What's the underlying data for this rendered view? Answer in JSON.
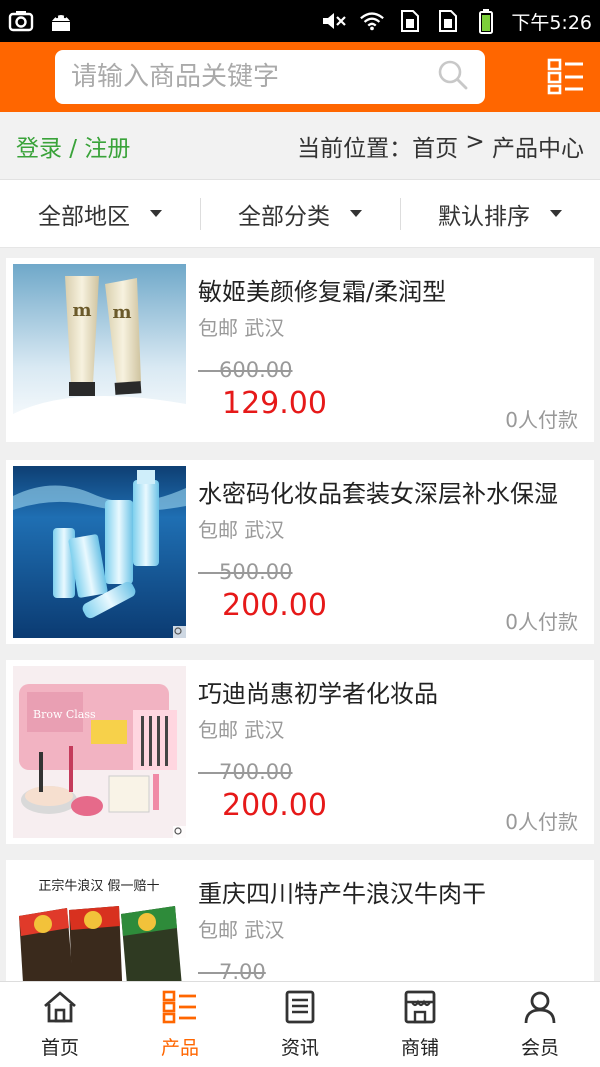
{
  "status_bar": {
    "time": "下午5:26",
    "left_icons": [
      "screenshot-icon",
      "android-icon"
    ],
    "right_icons": [
      "mute-icon",
      "wifi-icon",
      "sim1-icon",
      "sim2-icon",
      "battery-icon"
    ]
  },
  "header": {
    "search_placeholder": "请输入商品关键字",
    "icons": [
      "search-icon",
      "menu-icon"
    ]
  },
  "location": {
    "login": "登录 / 注册",
    "breadcrumb_prefix": "当前位置：",
    "home": "首页",
    "sep": " > ",
    "current": "产品中心"
  },
  "filters": [
    {
      "label": "全部地区"
    },
    {
      "label": "全部分类"
    },
    {
      "label": "默认排序"
    }
  ],
  "products": [
    {
      "title": "敏姬美颜修复霜/柔润型",
      "shipping": "包邮",
      "city": "武汉",
      "old_price": "600.00",
      "price": "129.00",
      "sold": "0人付款"
    },
    {
      "title": "水密码化妆品套装女深层补水保湿",
      "shipping": "包邮",
      "city": "武汉",
      "old_price": "500.00",
      "price": "200.00",
      "sold": "0人付款"
    },
    {
      "title": "巧迪尚惠初学者化妆品",
      "shipping": "包邮",
      "city": "武汉",
      "old_price": "700.00",
      "price": "200.00",
      "sold": "0人付款"
    },
    {
      "title": "重庆四川特产牛浪汉牛肉干",
      "shipping": "包邮",
      "city": "武汉",
      "old_price": "7.00",
      "price": "",
      "sold": ""
    }
  ],
  "product_images": {
    "img4_caption": "正宗牛浪汉  假一赔十",
    "img3_label": "Brow Class"
  },
  "bottom_nav": [
    {
      "label": "首页",
      "icon": "home-icon"
    },
    {
      "label": "产品",
      "icon": "product-icon",
      "active": true
    },
    {
      "label": "资讯",
      "icon": "news-icon"
    },
    {
      "label": "商铺",
      "icon": "shop-icon"
    },
    {
      "label": "会员",
      "icon": "member-icon"
    }
  ],
  "colors": {
    "brand": "#ff6600",
    "price_red": "#e61919",
    "login_green": "#3aa33a"
  }
}
